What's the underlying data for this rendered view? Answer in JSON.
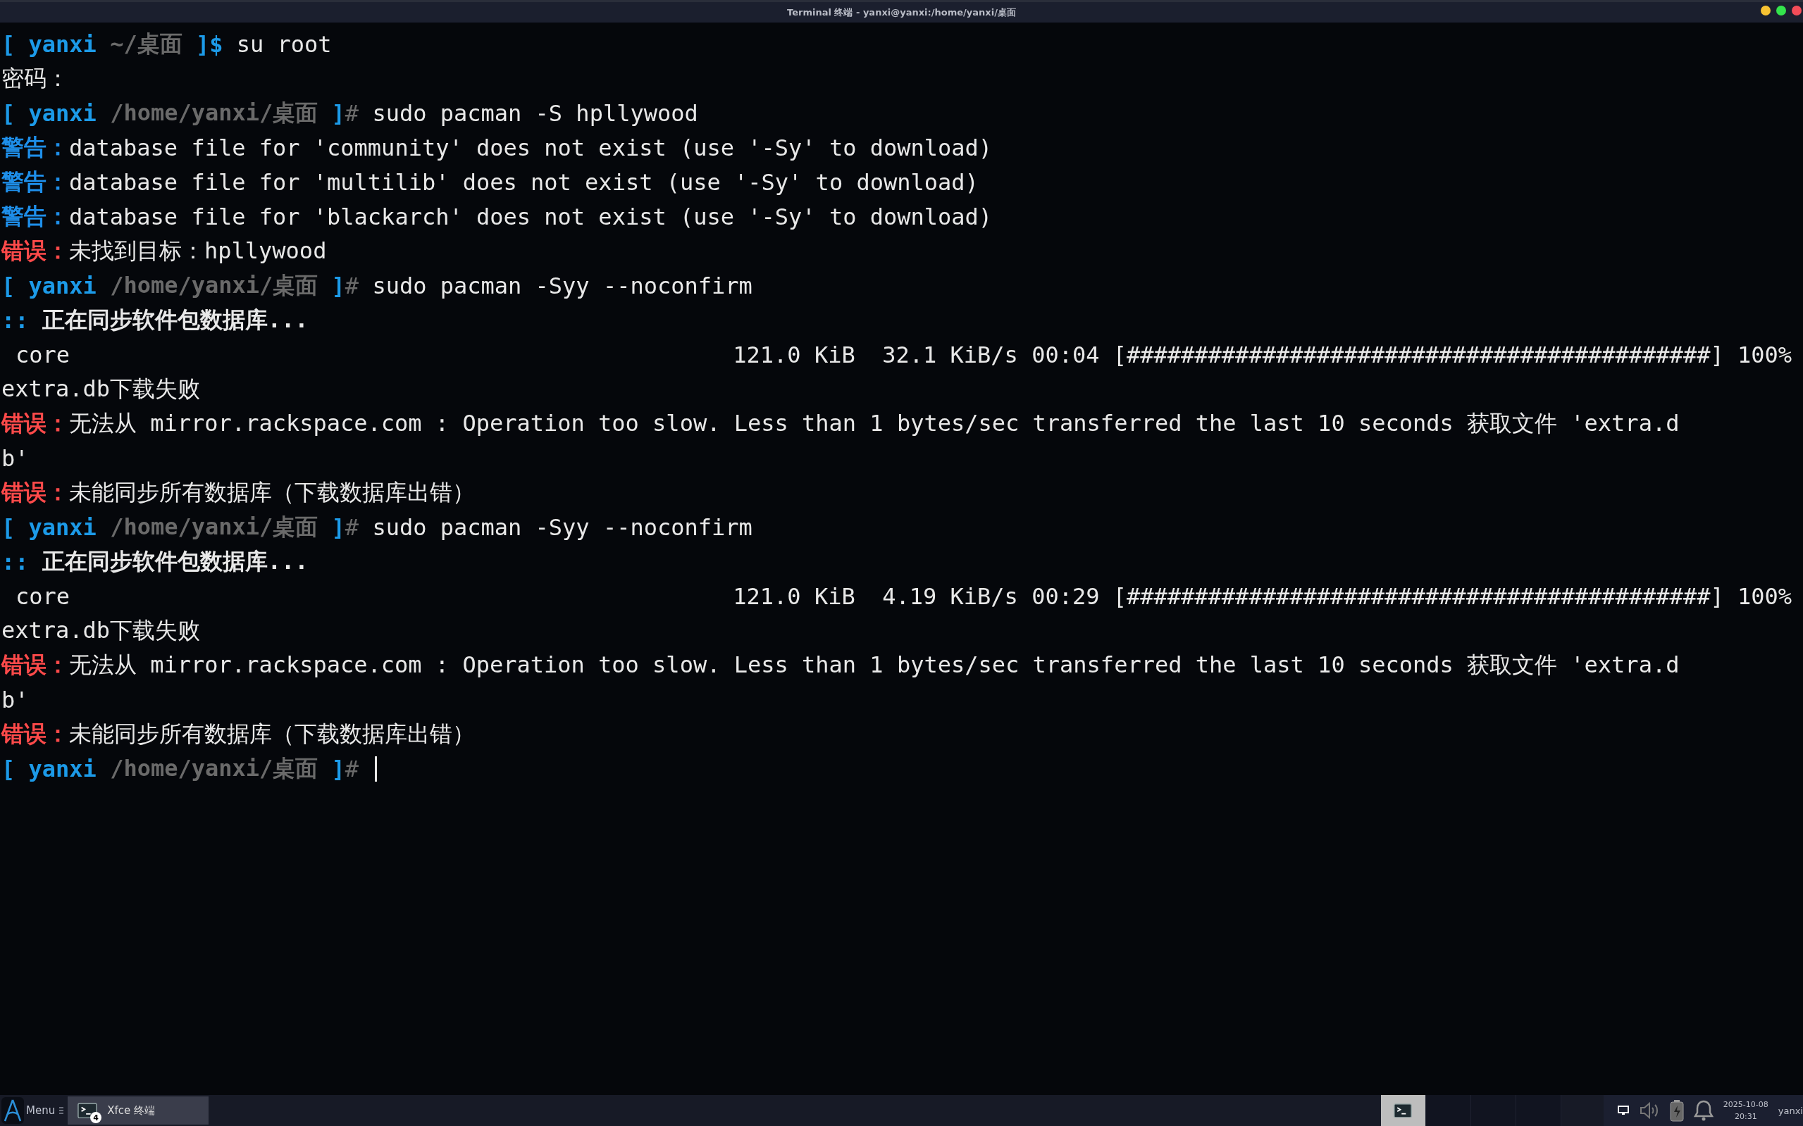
{
  "window": {
    "title": "Terminal 终端 - yanxi@yanxi:/home/yanxi/桌面",
    "buttons": [
      {
        "kind": "minimize"
      },
      {
        "kind": "maximize"
      },
      {
        "kind": "close"
      }
    ]
  },
  "terminal": {
    "lines": [
      {
        "kind": "prompt",
        "open": "[",
        "user": "yanxi",
        "path": "~/桌面",
        "close": "]",
        "symbol": "$",
        "privileged": false,
        "command": "su root",
        "cursor": false
      },
      {
        "kind": "plain",
        "text": "密码："
      },
      {
        "kind": "prompt",
        "open": "[",
        "user": "yanxi",
        "path": "/home/yanxi/桌面",
        "close": "]",
        "symbol": "#",
        "privileged": true,
        "command": "sudo pacman -S hpllywood",
        "cursor": false
      },
      {
        "kind": "warning",
        "label": "警告：",
        "text": "database file for 'community' does not exist (use '-Sy' to download)"
      },
      {
        "kind": "warning",
        "label": "警告：",
        "text": "database file for 'multilib' does not exist (use '-Sy' to download)"
      },
      {
        "kind": "warning",
        "label": "警告：",
        "text": "database file for 'blackarch' does not exist (use '-Sy' to download)"
      },
      {
        "kind": "error",
        "label": "错误：",
        "text": "未找到目标：hpllywood"
      },
      {
        "kind": "prompt",
        "open": "[",
        "user": "yanxi",
        "path": "/home/yanxi/桌面",
        "close": "]",
        "symbol": "#",
        "privileged": true,
        "command": "sudo pacman -Syy --noconfirm",
        "cursor": false
      },
      {
        "kind": "sync",
        "marker": "::",
        "text": "正在同步软件包数据库..."
      },
      {
        "kind": "progress",
        "name": "core",
        "size": "121.0 KiB",
        "speed": "32.1 KiB/s",
        "time": "00:04",
        "bar": "[###########################################]",
        "percent": "100%"
      },
      {
        "kind": "plain",
        "text": "extra.db下载失败"
      },
      {
        "kind": "error",
        "label": "错误：",
        "text": "无法从 mirror.rackspace.com : Operation too slow. Less than 1 bytes/sec transferred the last 10 seconds 获取文件 'extra.d"
      },
      {
        "kind": "plain",
        "text": "b'"
      },
      {
        "kind": "error",
        "label": "错误：",
        "text": "未能同步所有数据库（下载数据库出错）"
      },
      {
        "kind": "prompt",
        "open": "[",
        "user": "yanxi",
        "path": "/home/yanxi/桌面",
        "close": "]",
        "symbol": "#",
        "privileged": true,
        "command": "sudo pacman -Syy --noconfirm",
        "cursor": false
      },
      {
        "kind": "sync",
        "marker": "::",
        "text": "正在同步软件包数据库..."
      },
      {
        "kind": "progress",
        "name": "core",
        "size": "121.0 KiB",
        "speed": "4.19 KiB/s",
        "time": "00:29",
        "bar": "[###########################################]",
        "percent": "100%"
      },
      {
        "kind": "plain",
        "text": "extra.db下载失败"
      },
      {
        "kind": "error",
        "label": "错误：",
        "text": "无法从 mirror.rackspace.com : Operation too slow. Less than 1 bytes/sec transferred the last 10 seconds 获取文件 'extra.d"
      },
      {
        "kind": "plain",
        "text": "b'"
      },
      {
        "kind": "error",
        "label": "错误：",
        "text": "未能同步所有数据库（下载数据库出错）"
      },
      {
        "kind": "prompt",
        "open": "[",
        "user": "yanxi",
        "path": "/home/yanxi/桌面",
        "close": "]",
        "symbol": "#",
        "privileged": true,
        "cursor": true
      }
    ]
  },
  "taskbar": {
    "menu_label": "Menu",
    "tasks": [
      {
        "label": "Xfce 终端",
        "badge": "4",
        "selected": true
      }
    ],
    "workspaces": [
      {
        "selected": true
      },
      {
        "selected": false
      },
      {
        "selected": false
      },
      {
        "selected": false
      }
    ],
    "clock": {
      "date": "2025-10-08",
      "time": "20:31"
    },
    "user": "yanxi"
  }
}
